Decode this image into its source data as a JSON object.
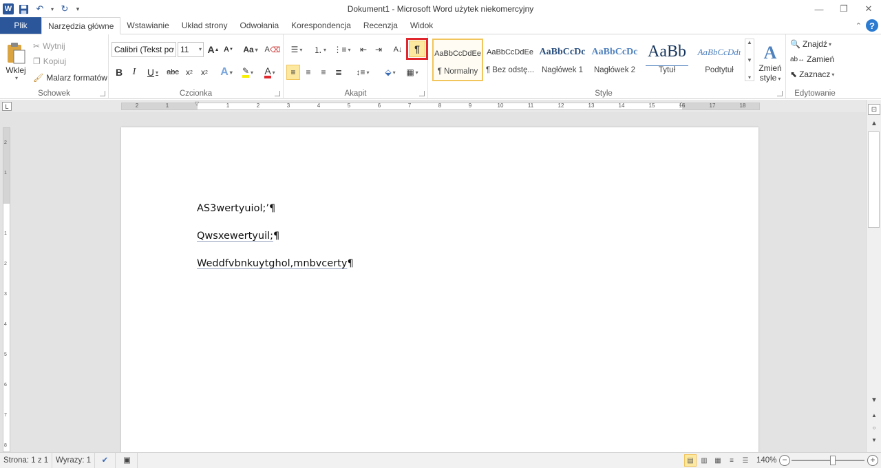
{
  "window": {
    "title": "Dokument1  -  Microsoft Word użytek niekomercyjny",
    "minimize": "—",
    "restore": "❐",
    "close": "✕"
  },
  "qat": {
    "logo": "W",
    "save_icon": "save-icon",
    "undo_icon": "undo-icon",
    "redo_icon": "repeat-icon",
    "customize_icon": "customize-icon"
  },
  "tabs": [
    "Plik",
    "Narzędzia główne",
    "Wstawianie",
    "Układ strony",
    "Odwołania",
    "Korespondencja",
    "Recenzja",
    "Widok"
  ],
  "ribbon": {
    "clipboard": {
      "label": "Schowek",
      "paste": "Wklej",
      "cut": "Wytnij",
      "copy": "Kopiuj",
      "format_painter": "Malarz formatów"
    },
    "font": {
      "label": "Czcionka",
      "font_name": "Calibri (Tekst po",
      "font_size": "11"
    },
    "paragraph": {
      "label": "Akapit",
      "show_marks": "¶"
    },
    "styles": {
      "label": "Style",
      "items": [
        {
          "sample": "AaBbCcDdEe",
          "name": "¶ Normalny"
        },
        {
          "sample": "AaBbCcDdEe",
          "name": "¶ Bez odstę..."
        },
        {
          "sample": "AaBbCcDc",
          "name": "Nagłówek 1"
        },
        {
          "sample": "AaBbCcDc",
          "name": "Nagłówek 2"
        },
        {
          "sample": "AaBb",
          "name": "Tytuł"
        },
        {
          "sample": "AaBbCcDdı",
          "name": "Podtytuł"
        }
      ],
      "change_line1": "Zmień",
      "change_line2": "style"
    },
    "editing": {
      "label": "Edytowanie",
      "find": "Znajdź",
      "replace": "Zamień",
      "select": "Zaznacz"
    }
  },
  "ruler": {
    "corner": "L",
    "numbers": [
      "2",
      "1",
      "1",
      "2",
      "3",
      "4",
      "5",
      "6",
      "7",
      "8",
      "9",
      "10",
      "11",
      "12",
      "13",
      "14",
      "15",
      "16",
      "17",
      "18"
    ]
  },
  "vruler": {
    "numbers": [
      "2",
      "1",
      "1",
      "2",
      "3",
      "4",
      "5",
      "6",
      "7",
      "8"
    ]
  },
  "document": {
    "paragraphs": [
      {
        "text": "AS3wertyuiol;’",
        "mark": "¶"
      },
      {
        "text": "Qwsxewertyuil;",
        "mark": "¶"
      },
      {
        "text": "Weddfvbnkuytghol,mnbvcerty",
        "mark": "¶"
      }
    ]
  },
  "status": {
    "page": "Strona: 1 z 1",
    "words": "Wyrazy: 1",
    "zoom": "140%",
    "zoom_minus": "−",
    "zoom_plus": "+"
  }
}
